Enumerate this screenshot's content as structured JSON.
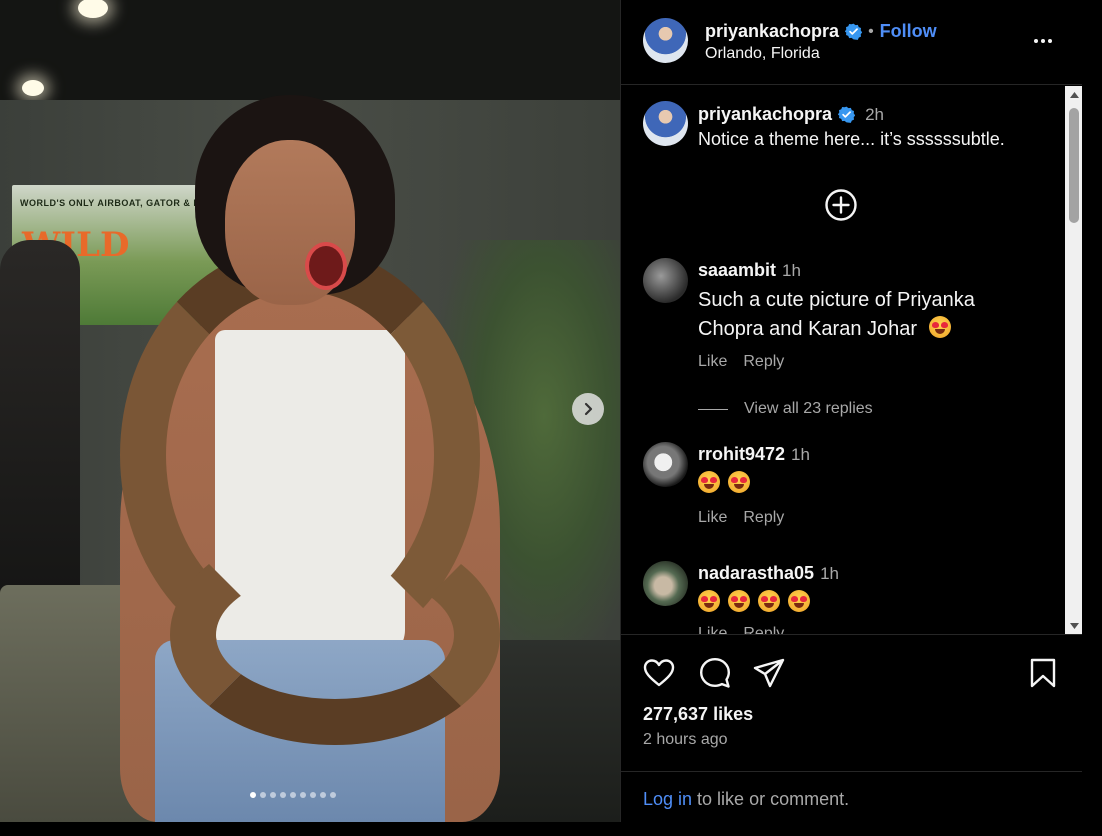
{
  "post": {
    "username": "priyankachopra",
    "follow_label": "Follow",
    "bullet": "•",
    "location": "Orlando, Florida",
    "caption_time": "2h",
    "caption": "Notice a theme here... it’s ssssssubtle.",
    "likes": "277,637 likes",
    "posted": "2 hours ago",
    "login_link": "Log in",
    "login_rest": " to like or comment.",
    "carousel_count": 9,
    "carousel_active": 0
  },
  "photo": {
    "banner_small": "WORLD'S ONLY AIRBOAT, GATOR & DRIVE",
    "banner_big": "WILD"
  },
  "comments": [
    {
      "user": "saaambit",
      "time": "1h",
      "text": "Such a cute picture of Priyanka Chopra and Karan Johar",
      "emoji_count": 1,
      "like": "Like",
      "reply": "Reply"
    },
    {
      "user": "rrohit9472",
      "time": "1h",
      "text": "",
      "emoji_count": 2,
      "like": "Like",
      "reply": "Reply"
    },
    {
      "user": "nadarastha05",
      "time": "1h",
      "text": "",
      "emoji_count": 4,
      "like": "Like",
      "reply": "Reply"
    }
  ],
  "view_replies": "View all 23 replies",
  "colors": {
    "accent": "#4f8ef7",
    "muted": "#a8a8a8",
    "text": "#f5f5f5",
    "verified": "#3797f0"
  },
  "icons": [
    "chevron-right-icon",
    "verified-badge-icon",
    "more-options-icon",
    "plus-circle-icon",
    "heart-icon",
    "comment-icon",
    "share-icon",
    "bookmark-icon",
    "heart-eyes-emoji"
  ]
}
